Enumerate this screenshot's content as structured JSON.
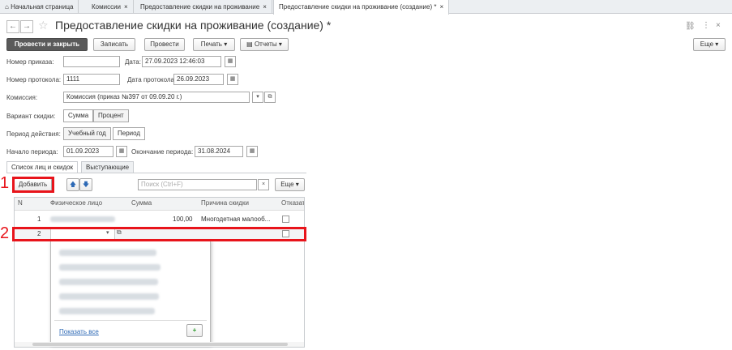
{
  "tabs": [
    {
      "label": "Начальная страница",
      "icon": "home-icon"
    },
    {
      "label": "Комиссии",
      "close": "×"
    },
    {
      "label": "Предоставление скидки на проживание",
      "close": "×"
    },
    {
      "label": "Предоставление скидки на проживание (создание) *",
      "close": "×"
    }
  ],
  "window": {
    "title": "Предоставление скидки на проживание (создание) *"
  },
  "toolbar": {
    "post_close": "Провести и закрыть",
    "save": "Записать",
    "post": "Провести",
    "print": "Печать",
    "reports": "Отчеты",
    "more": "Еще"
  },
  "form": {
    "order_no_label": "Номер приказа:",
    "order_no_value": "",
    "date_label": "Дата:",
    "date_value": "27.09.2023 12:46:03",
    "protocol_no_label": "Номер протокола:",
    "protocol_no_value": "1111",
    "protocol_date_label": "Дата протокола:",
    "protocol_date_value": "26.09.2023",
    "commission_label": "Комиссия:",
    "commission_value": "Комиссия (приказ №397 от 09.09.20 г.)",
    "variant_label": "Вариант скидки:",
    "variant_sum": "Сумма",
    "variant_percent": "Процент",
    "period_label": "Период действия:",
    "period_year": "Учебный год",
    "period_period": "Период",
    "start_label": "Начало периода:",
    "start_value": "01.09.2023",
    "end_label": "Окончание периода:",
    "end_value": "31.08.2024"
  },
  "subtabs": [
    "Список лиц и скидок",
    "Выступающие"
  ],
  "table_toolbar": {
    "add": "Добавить",
    "search_placeholder": "Поиск (Ctrl+F)",
    "clear": "×",
    "more": "Еще"
  },
  "table": {
    "columns": [
      "N",
      "Физическое лицо",
      "Сумма",
      "Причина скидки",
      "Отказат"
    ],
    "rows": [
      {
        "n": "1",
        "person": "",
        "sum": "100,00",
        "reason": "Многодетная малооб...",
        "refused": false
      },
      {
        "n": "2",
        "person": "",
        "sum": "",
        "reason": "",
        "refused": false
      }
    ]
  },
  "dropdown": {
    "show_all": "Показать все",
    "add": "+"
  },
  "annotations": {
    "one": "1",
    "two": "2"
  },
  "colors": {
    "accent_red": "#e8141b",
    "primary_button": "#5a5a5a",
    "link": "#2d69b5"
  }
}
